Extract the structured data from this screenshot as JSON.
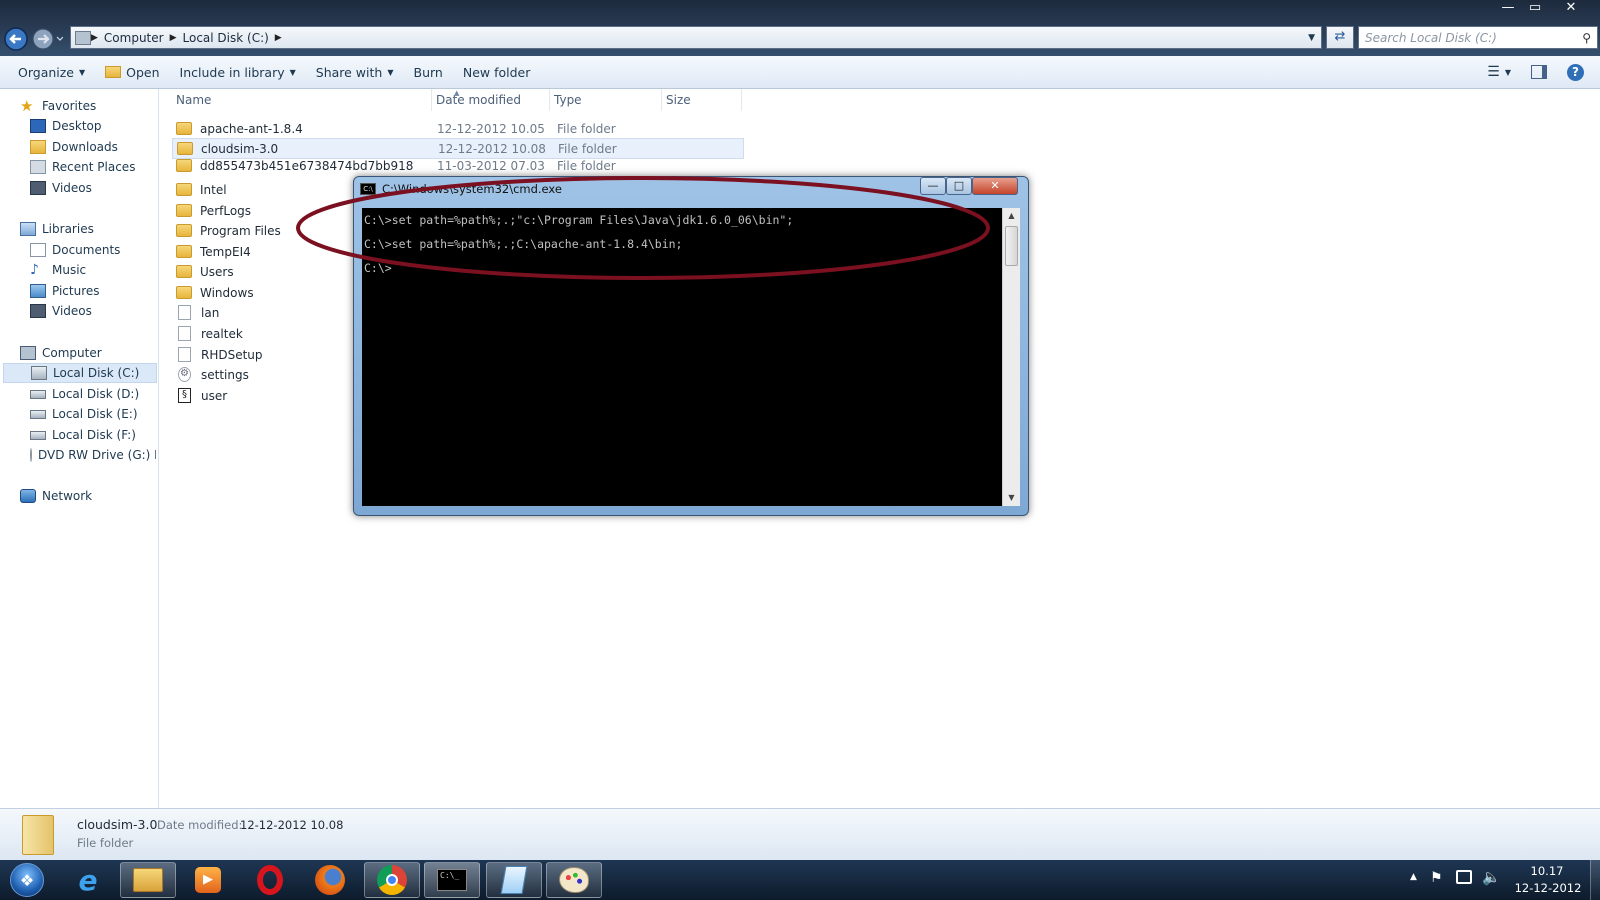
{
  "window": {
    "minimize": "—",
    "maximize": "▭",
    "close": "✕"
  },
  "address": {
    "crumbs": [
      "Computer",
      "Local Disk (C:)"
    ],
    "search_placeholder": "Search Local Disk (C:)"
  },
  "toolbar": {
    "organize": "Organize",
    "open": "Open",
    "include": "Include in library",
    "share": "Share with",
    "burn": "Burn",
    "new_folder": "New folder"
  },
  "nav": {
    "favorites": "Favorites",
    "desktop": "Desktop",
    "downloads": "Downloads",
    "recent": "Recent Places",
    "videos_fav": "Videos",
    "libraries": "Libraries",
    "documents": "Documents",
    "music": "Music",
    "pictures": "Pictures",
    "videos_lib": "Videos",
    "computer": "Computer",
    "disk_c": "Local Disk (C:)",
    "disk_d": "Local Disk (D:)",
    "disk_e": "Local Disk (E:)",
    "disk_f": "Local Disk (F:)",
    "dvd": "DVD RW Drive (G:) N",
    "network": "Network"
  },
  "columns": {
    "name": "Name",
    "date": "Date modified",
    "type": "Type",
    "size": "Size"
  },
  "files": [
    {
      "name": "apache-ant-1.8.4",
      "date": "12-12-2012 10.05",
      "type": "File folder"
    },
    {
      "name": "cloudsim-3.0",
      "date": "12-12-2012 10.08",
      "type": "File folder"
    },
    {
      "name": "dd855473b451e6738474bd7bb918",
      "date": "11-03-2012 07.03",
      "type": "File folder"
    },
    {
      "name": "Intel"
    },
    {
      "name": "PerfLogs"
    },
    {
      "name": "Program Files"
    },
    {
      "name": "TempEI4"
    },
    {
      "name": "Users"
    },
    {
      "name": "Windows"
    },
    {
      "name": "lan"
    },
    {
      "name": "realtek"
    },
    {
      "name": "RHDSetup"
    },
    {
      "name": "settings"
    },
    {
      "name": "user"
    }
  ],
  "cmd": {
    "title": "C:\\Windows\\system32\\cmd.exe",
    "lines": [
      "C:\\>set path=%path%;.;\"c:\\Program Files\\Java\\jdk1.6.0_06\\bin\";",
      "C:\\>set path=%path%;.;C:\\apache-ant-1.8.4\\bin;",
      "C:\\>"
    ],
    "annotation_color": "#7a1020"
  },
  "details": {
    "name": "cloudsim-3.0",
    "date_label": "Date modified:",
    "date_value": "12-12-2012 10.08",
    "type": "File folder"
  },
  "taskbar": {
    "time": "10.17",
    "date": "12-12-2012",
    "apps": [
      "start-orb",
      "internet-explorer",
      "windows-explorer",
      "media-player",
      "opera",
      "firefox",
      "chrome",
      "cmd",
      "notepad",
      "paint"
    ]
  }
}
